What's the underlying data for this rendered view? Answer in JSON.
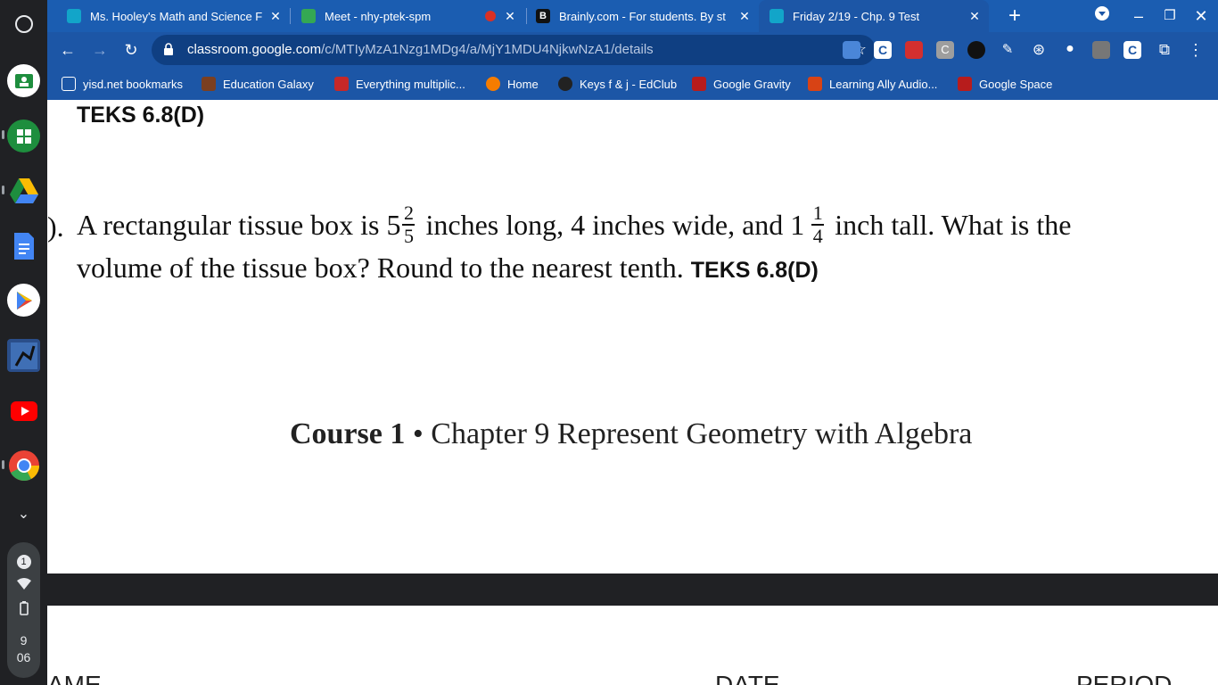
{
  "shelf": {
    "notification_count": "1",
    "time_hour": "9",
    "time_min": "06",
    "apps": [
      "classroom-icon",
      "sheets-icon",
      "drive-icon",
      "docs-icon",
      "play-store-icon",
      "game-app-icon",
      "youtube-icon",
      "chrome-icon"
    ]
  },
  "tabs": [
    {
      "title": "Ms. Hooley's Math and Science F",
      "active": false,
      "color": "#12a5c9"
    },
    {
      "title": "Meet - nhy-ptek-spm",
      "active": false,
      "color": "#34a853"
    },
    {
      "title": "Brainly.com - For students. By st",
      "active": false,
      "color": "#111111"
    },
    {
      "title": "Friday 2/19 - Chp. 9 Test",
      "active": true,
      "color": "#12a5c9"
    }
  ],
  "toolbar": {
    "url_host": "classroom.google.com",
    "url_path": "/c/MTIyMzA1Nzg1MDg4/a/MjY1MDU4NjkwNzA1/details"
  },
  "bookmarks": [
    {
      "label": "yisd.net bookmarks",
      "color": "#ffffff"
    },
    {
      "label": "Education Galaxy",
      "color": "#7b3f20"
    },
    {
      "label": "Everything multiplic...",
      "color": "#c62828"
    },
    {
      "label": "Home",
      "color": "#f57c00"
    },
    {
      "label": "Keys f & j - EdClub",
      "color": "#222222"
    },
    {
      "label": "Google Gravity",
      "color": "#b71c1c"
    },
    {
      "label": "Learning Ally Audio...",
      "color": "#d84315"
    },
    {
      "label": "Google Space",
      "color": "#b71c1c"
    }
  ],
  "document": {
    "prev_teks": "TEKS 6.8(D)",
    "question_number": ").",
    "q_part1": "A rectangular tissue box is 5",
    "frac1_num": "2",
    "frac1_den": "5",
    "q_part2": " inches long, 4 inches wide, and 1",
    "frac2_num": "1",
    "frac2_den": "4",
    "q_part3": " inch tall. What is the",
    "q_line2": "volume of the tissue box? Round to the nearest tenth. ",
    "q_teks": "TEKS 6.8(D)",
    "footer_course": "Course 1",
    "footer_rest": " • Chapter 9 Represent Geometry with Algebra",
    "next_name": "AME",
    "next_date": "DATE",
    "next_period": "PERIOD"
  }
}
